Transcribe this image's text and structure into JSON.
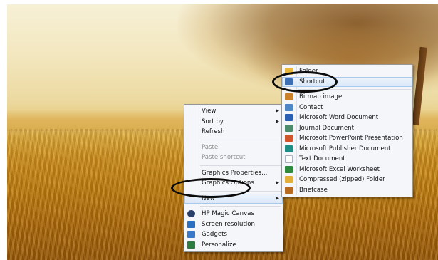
{
  "context_menu": {
    "items_top": [
      {
        "label": "View",
        "has_submenu": true
      },
      {
        "label": "Sort by",
        "has_submenu": true
      },
      {
        "label": "Refresh",
        "has_submenu": false
      }
    ],
    "items_paste": [
      {
        "label": "Paste",
        "disabled": true
      },
      {
        "label": "Paste shortcut",
        "disabled": true
      }
    ],
    "items_graphics": [
      {
        "label": "Graphics Properties...",
        "has_submenu": false
      },
      {
        "label": "Graphics Options",
        "has_submenu": true
      }
    ],
    "item_new": {
      "label": "New",
      "has_submenu": true
    },
    "items_bottom": [
      {
        "label": "HP Magic Canvas",
        "icon": "hp-magic-canvas-icon",
        "color": "#2b3f6b"
      },
      {
        "label": "Screen resolution",
        "icon": "monitor-icon",
        "color": "#2a6fc2"
      },
      {
        "label": "Gadgets",
        "icon": "gadgets-icon",
        "color": "#3a78c8"
      },
      {
        "label": "Personalize",
        "icon": "personalize-icon",
        "color": "#2f7a3f"
      }
    ]
  },
  "new_submenu": {
    "items": [
      {
        "label": "Folder",
        "icon": "folder-icon",
        "color": "#e8b73a"
      },
      {
        "label": "Shortcut",
        "icon": "shortcut-icon",
        "color": "#3d6fb5"
      },
      {
        "label": "Bitmap image",
        "icon": "bitmap-icon",
        "color": "#c9822b"
      },
      {
        "label": "Contact",
        "icon": "contact-icon",
        "color": "#4f86c6"
      },
      {
        "label": "Microsoft Word Document",
        "icon": "word-icon",
        "color": "#2b5fb4"
      },
      {
        "label": "Journal Document",
        "icon": "journal-icon",
        "color": "#4e8c6e"
      },
      {
        "label": "Microsoft PowerPoint Presentation",
        "icon": "powerpoint-icon",
        "color": "#d0552b"
      },
      {
        "label": "Microsoft Publisher Document",
        "icon": "publisher-icon",
        "color": "#1e8d86"
      },
      {
        "label": "Text Document",
        "icon": "text-document-icon",
        "color": "#cfd5de"
      },
      {
        "label": "Microsoft Excel Worksheet",
        "icon": "excel-icon",
        "color": "#2e8b3d"
      },
      {
        "label": "Compressed (zipped) Folder",
        "icon": "zip-folder-icon",
        "color": "#e2b03a"
      },
      {
        "label": "Briefcase",
        "icon": "briefcase-icon",
        "color": "#b86a1f"
      }
    ]
  }
}
